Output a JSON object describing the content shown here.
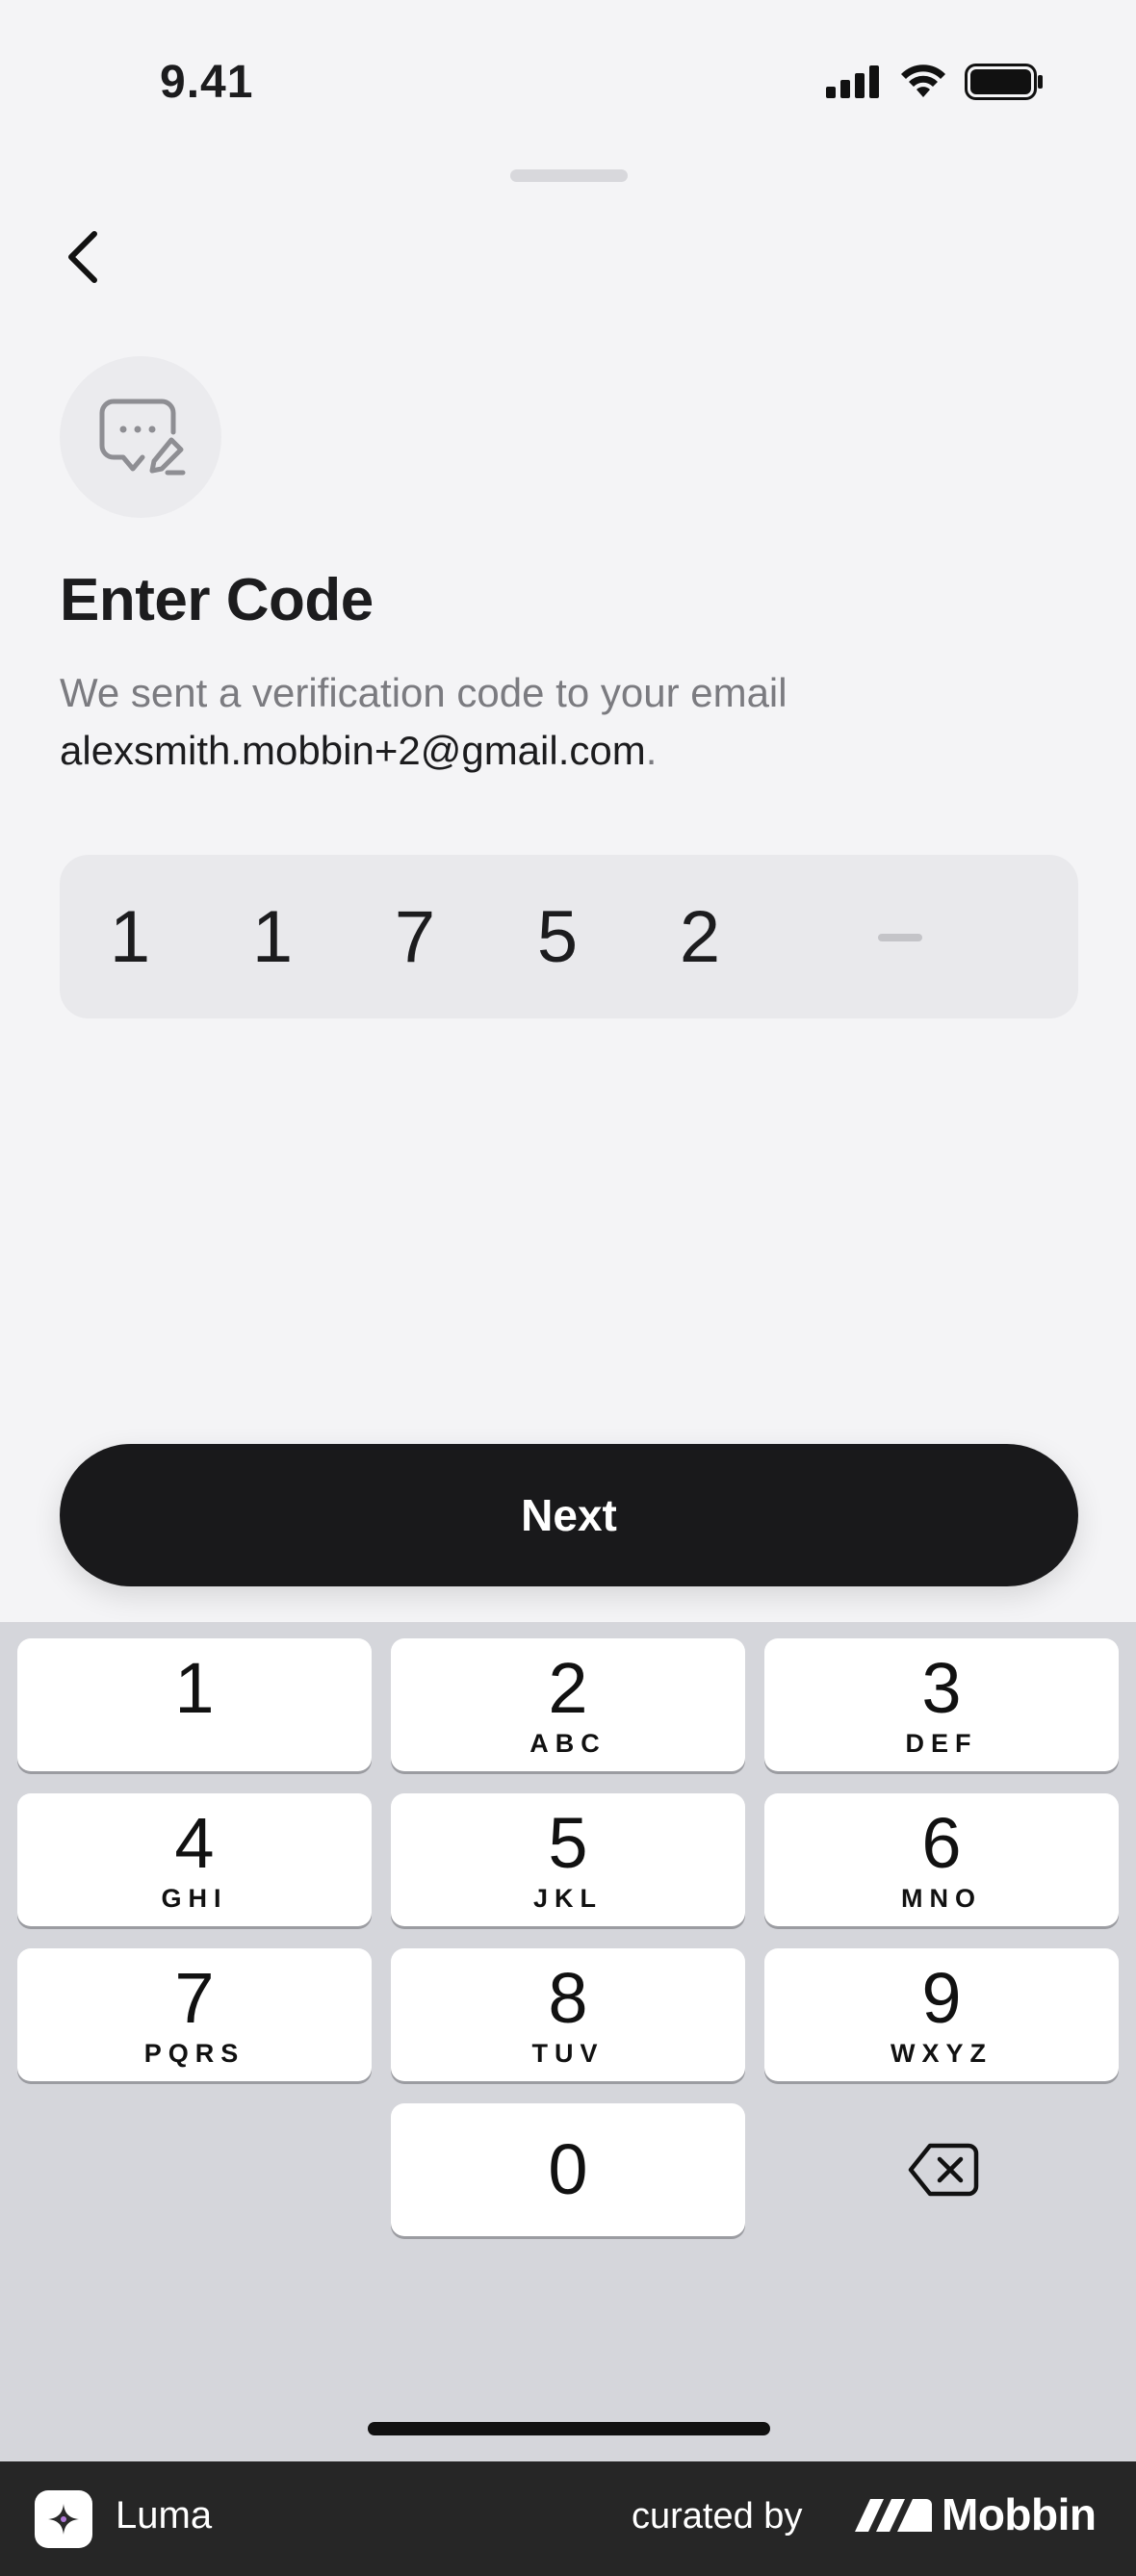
{
  "status_bar": {
    "time": "9.41",
    "icons": [
      "signal-icon",
      "wifi-icon",
      "battery-icon"
    ]
  },
  "header": {
    "back_icon": "chevron-left-icon",
    "illustration_icon": "message-edit-icon"
  },
  "content": {
    "title": "Enter Code",
    "subtitle": "We sent a verification code to your email",
    "email": "alexsmith.mobbin+2@gmail.com",
    "email_suffix": "."
  },
  "code_input": {
    "digits": [
      "1",
      "1",
      "7",
      "5",
      "2"
    ],
    "empty_slot_placeholder": "–"
  },
  "actions": {
    "next_label": "Next"
  },
  "keyboard": {
    "keys": [
      {
        "num": "1",
        "letters": ""
      },
      {
        "num": "2",
        "letters": "ABC"
      },
      {
        "num": "3",
        "letters": "DEF"
      },
      {
        "num": "4",
        "letters": "GHI"
      },
      {
        "num": "5",
        "letters": "JKL"
      },
      {
        "num": "6",
        "letters": "MNO"
      },
      {
        "num": "7",
        "letters": "PQRS"
      },
      {
        "num": "8",
        "letters": "TUV"
      },
      {
        "num": "9",
        "letters": "WXYZ"
      },
      {
        "num": "0",
        "letters": ""
      }
    ],
    "delete_icon": "backspace-icon"
  },
  "footer": {
    "app_name": "Luma",
    "curated_by": "curated by",
    "brand": "Mobbin"
  },
  "colors": {
    "background": "#f4f4f6",
    "primary_button": "#19191b",
    "keyboard_bg": "#d5d6db",
    "footer_bg": "#262626"
  }
}
